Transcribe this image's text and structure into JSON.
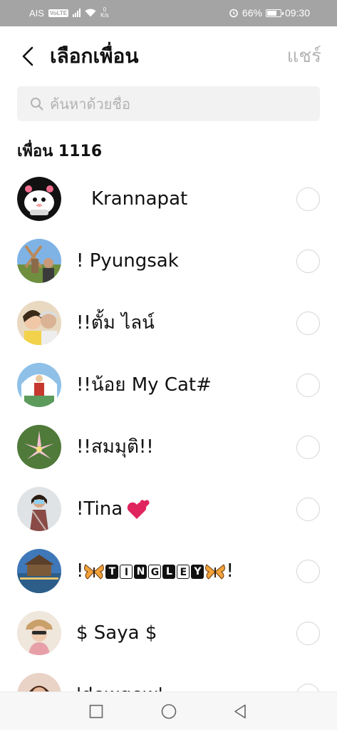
{
  "status_bar": {
    "carrier": "AIS",
    "network_badge": "VoLTE",
    "speed_value": "0",
    "speed_unit": "K/s",
    "battery": "66%",
    "time": "09:30"
  },
  "header": {
    "title": "เลือกเพื่อน",
    "share_label": "แชร์"
  },
  "search": {
    "placeholder": "ค้นหาด้วยชื่อ"
  },
  "section": {
    "title": "เพื่อน 1116"
  },
  "friends": [
    {
      "name": "Krannapat"
    },
    {
      "name": "! Pyungsak"
    },
    {
      "name": "!!ตั้ม ไลน์"
    },
    {
      "name": "!!น้อย My Cat#"
    },
    {
      "name": "!!สมมุติ!!"
    },
    {
      "name": "!Tina",
      "emoji": "two-hearts"
    },
    {
      "name_prefix": "!",
      "name_suffix": "!",
      "tiles": [
        "T",
        "I",
        "N",
        "G",
        "L",
        "E",
        "Y"
      ]
    },
    {
      "name": "$ Saya $"
    },
    {
      "name": "'dewqew'"
    }
  ],
  "colors": {
    "status_bar_bg": "#a4a4a4",
    "search_bg": "#f2f2f3",
    "share_text": "#b5b5b5",
    "radio_border": "#d5d5d5"
  },
  "icons": [
    "back-arrow-icon",
    "search-icon",
    "radio-unchecked-icon",
    "nav-recents-icon",
    "nav-home-icon",
    "nav-back-icon",
    "alarm-icon",
    "wifi-icon",
    "signal-icon",
    "battery-icon"
  ]
}
